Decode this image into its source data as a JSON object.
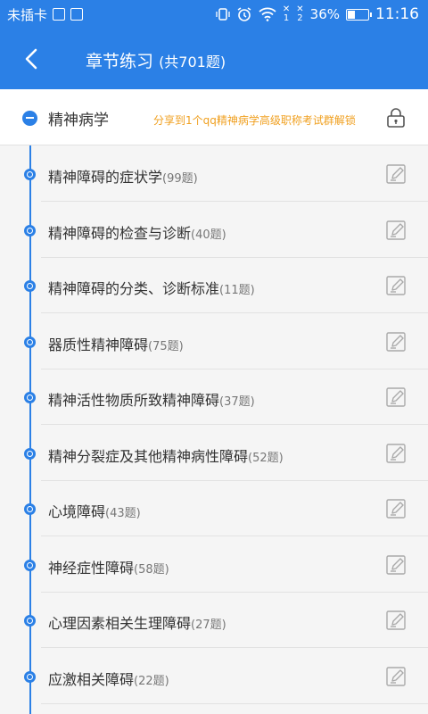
{
  "status_bar": {
    "carrier": "未插卡",
    "battery_percent": "36%",
    "battery_level": 0.36,
    "time": "11:16",
    "icons": [
      "no-sim-icon",
      "image-icon",
      "download-icon",
      "vibrate-icon",
      "alarm-icon",
      "wifi-icon",
      "sim1-icon",
      "sim2-icon",
      "battery-icon"
    ]
  },
  "header": {
    "title": "章节练习",
    "subtitle": "(共701题)",
    "back_icon": "chevron-left-icon"
  },
  "chapter": {
    "title": "精神病学",
    "share_text": "分享到1个qq精神病学高级职称考试群解锁",
    "lock_icon": "lock-icon"
  },
  "sections": [
    {
      "title": "精神障碍的症状学",
      "count": "(99题)"
    },
    {
      "title": "精神障碍的检查与诊断",
      "count": "(40题)"
    },
    {
      "title": "精神障碍的分类、诊断标准",
      "count": "(11题)"
    },
    {
      "title": "器质性精神障碍",
      "count": "(75题)"
    },
    {
      "title": "精神活性物质所致精神障碍",
      "count": "(37题)"
    },
    {
      "title": "精神分裂症及其他精神病性障碍",
      "count": "(52题)"
    },
    {
      "title": "心境障碍",
      "count": "(43题)"
    },
    {
      "title": "神经症性障碍",
      "count": "(58题)"
    },
    {
      "title": "心理因素相关生理障碍",
      "count": "(27题)"
    },
    {
      "title": "应激相关障碍",
      "count": "(22题)"
    }
  ],
  "colors": {
    "primary": "#2b80e6",
    "accent": "#f0a020",
    "background": "#f5f5f5"
  }
}
